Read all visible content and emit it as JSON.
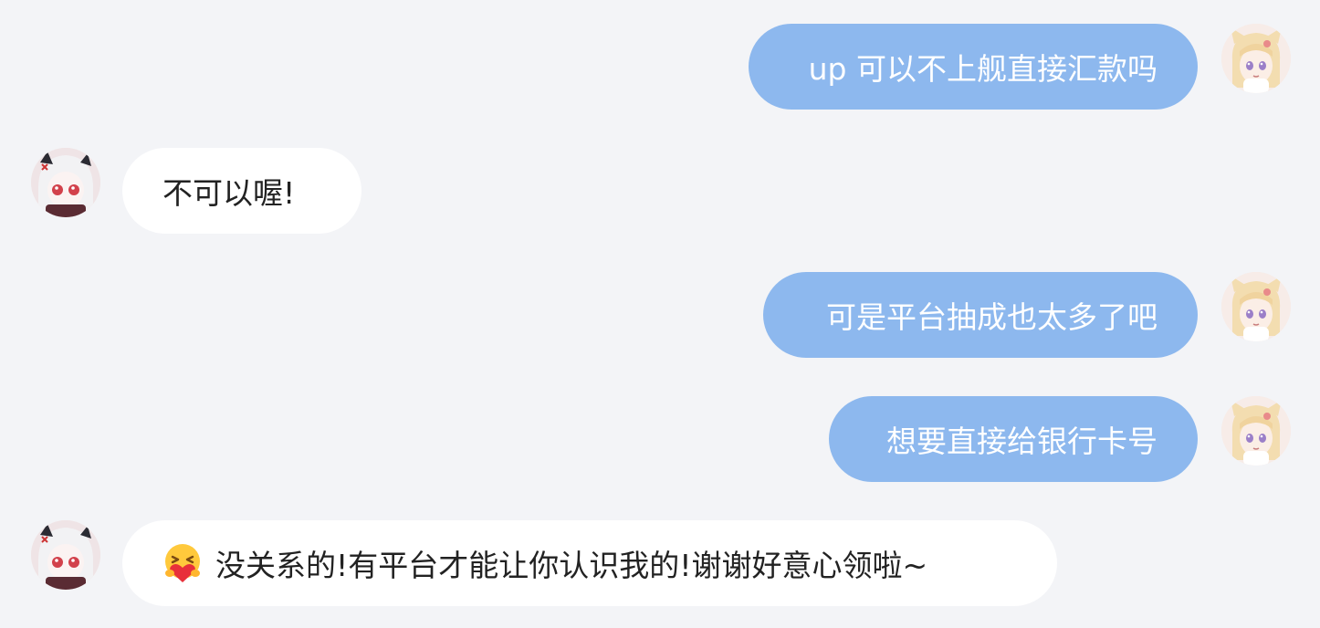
{
  "messages": [
    {
      "side": "right",
      "text": "up 可以不上舰直接汇款吗"
    },
    {
      "side": "left",
      "text": "不可以喔!"
    },
    {
      "side": "right",
      "text": "可是平台抽成也太多了吧"
    },
    {
      "side": "right",
      "text": "想要直接给银行卡号"
    },
    {
      "side": "left",
      "emoji": "hugging-heart-emoji",
      "text": "没关系的!有平台才能让你认识我的!谢谢好意心领啦~"
    }
  ],
  "colors": {
    "background": "#f3f4f7",
    "outgoing_bubble": "#8db8ee",
    "incoming_bubble": "#ffffff"
  }
}
